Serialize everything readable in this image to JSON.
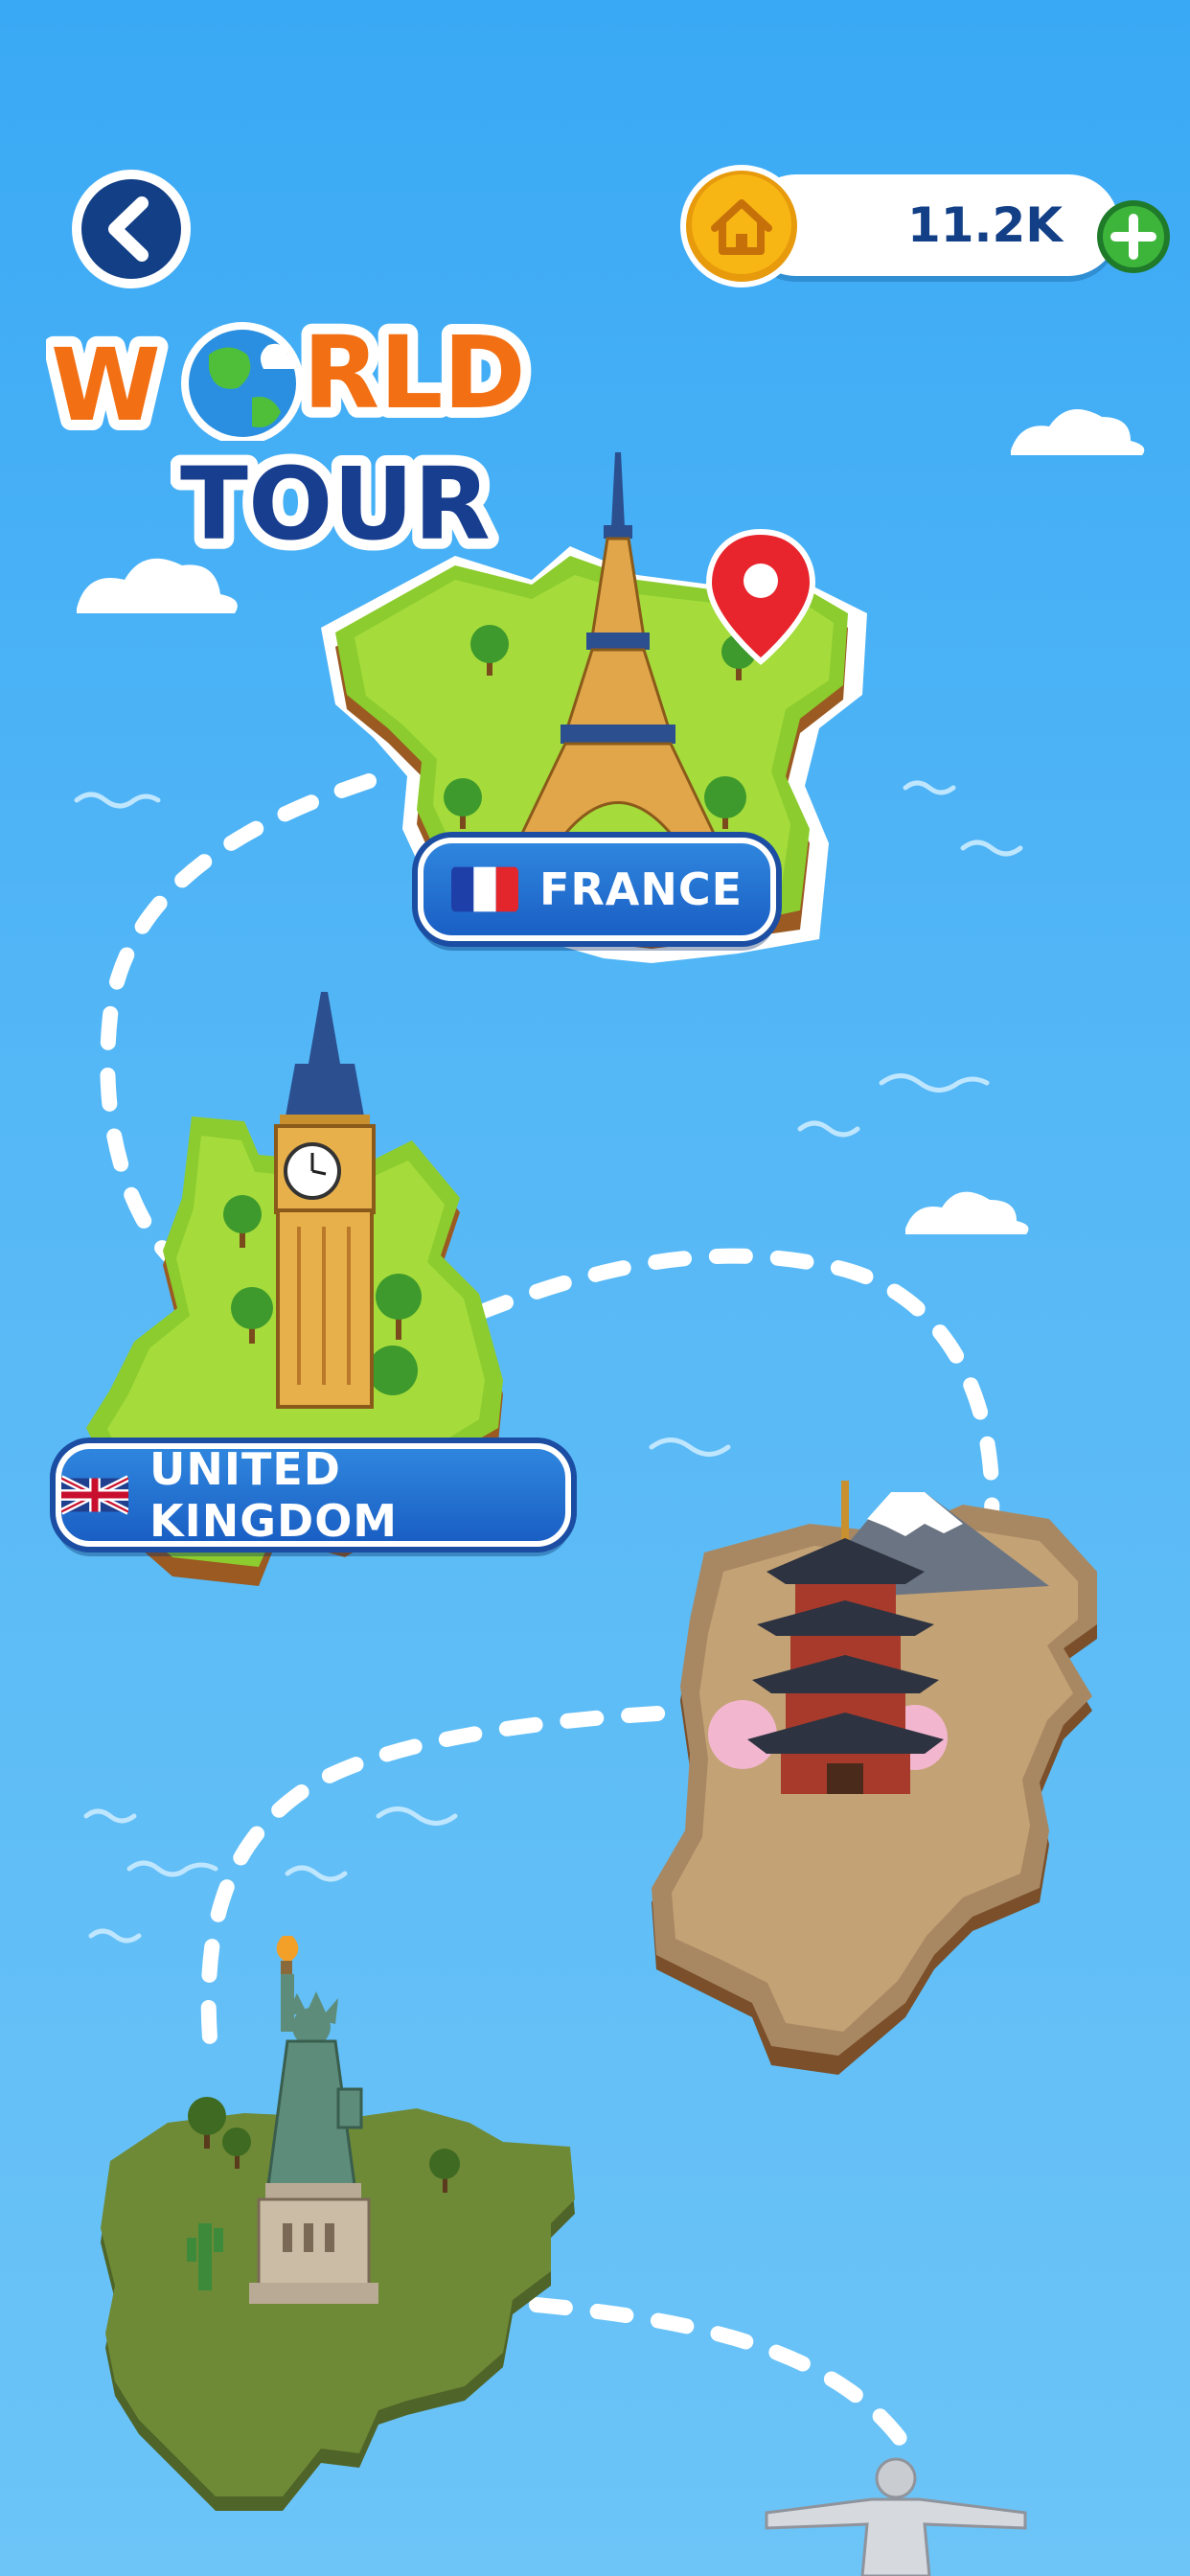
{
  "header": {
    "back_icon": "chevron-left-icon",
    "currency": {
      "icon": "home-coin-icon",
      "value": "11.2K",
      "add_icon": "plus-icon"
    }
  },
  "title": {
    "line1": "W",
    "line1_rest": "RLD",
    "line2": "TOUR",
    "globe_icon": "globe-icon"
  },
  "countries": [
    {
      "label": "FRANCE",
      "flag": "flag-france-icon",
      "landmark": "eiffel-tower"
    },
    {
      "label": "UNITED KINGDOM",
      "flag": "flag-uk-icon",
      "landmark": "big-ben"
    },
    {
      "landmark": "japanese-pagoda"
    },
    {
      "landmark": "statue-of-liberty"
    },
    {
      "landmark": "christ-the-redeemer"
    }
  ],
  "colors": {
    "sky": "#3aa9f5",
    "label_blue": "#1a5fc4",
    "title_orange": "#f26f13",
    "title_navy": "#173e8f",
    "coin_gold": "#f7b614",
    "add_green": "#3db53a"
  }
}
